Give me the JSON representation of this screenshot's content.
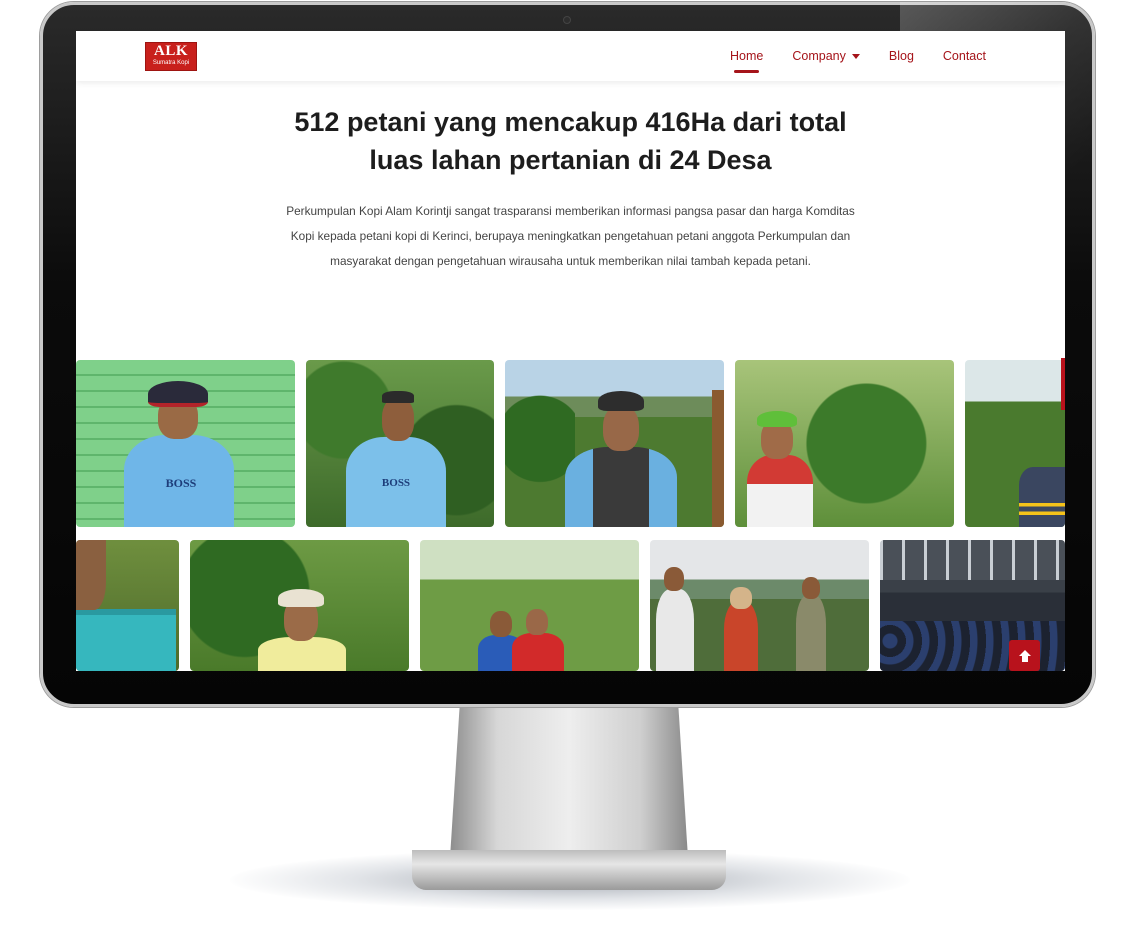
{
  "brand": {
    "logo_main": "ALK",
    "logo_sub": "Sumatra Kopi"
  },
  "nav": {
    "items": [
      {
        "label": "Home",
        "active": true
      },
      {
        "label": "Company",
        "dropdown": true
      },
      {
        "label": "Blog"
      },
      {
        "label": "Contact"
      }
    ]
  },
  "hero": {
    "title_line1": "512 petani yang mencakup 416Ha dari total",
    "title_line2": "luas lahan pertanian di 24 Desa",
    "description": "Perkumpulan Kopi Alam Korintji sangat trasparansi memberikan informasi pangsa pasar dan harga Komditas Kopi kepada petani kopi di Kerinci, berupaya meningkatkan pengetahuan petani anggota Perkumpulan dan masyarakat dengan pengetahuan wirausaha untuk memberikan nilai tambah kepada petani."
  },
  "gallery": {
    "shirt_text": "BOSS"
  },
  "colors": {
    "accent": "#a5141a",
    "brand_red": "#c8201c"
  },
  "icons": {
    "back_to_top": "arrow-up-icon"
  }
}
